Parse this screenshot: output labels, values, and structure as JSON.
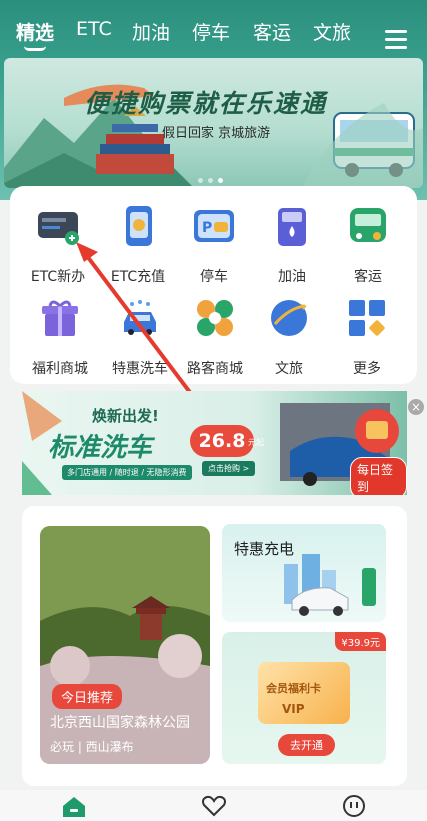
{
  "nav": {
    "tabs": [
      {
        "label": "精选",
        "active": true
      },
      {
        "label": "ETC",
        "active": false
      },
      {
        "label": "加油",
        "active": false
      },
      {
        "label": "停车",
        "active": false
      },
      {
        "label": "客运",
        "active": false
      },
      {
        "label": "文旅",
        "active": false
      }
    ],
    "menu_icon": "hamburger-menu-icon"
  },
  "banner": {
    "title": "便捷购票就在乐速通",
    "subtitle": "假日回家 京城旅游",
    "current_page": 3,
    "page_count": 3
  },
  "services": [
    {
      "label": "ETC新办",
      "icon": "etc-card-reader-icon"
    },
    {
      "label": "ETC充值",
      "icon": "etc-recharge-icon"
    },
    {
      "label": "停车",
      "icon": "parking-icon"
    },
    {
      "label": "加油",
      "icon": "fuel-pump-icon"
    },
    {
      "label": "客运",
      "icon": "bus-icon"
    },
    {
      "label": "福利商城",
      "icon": "gift-box-icon"
    },
    {
      "label": "特惠洗车",
      "icon": "car-wash-icon"
    },
    {
      "label": "路客商城",
      "icon": "mall-icon"
    },
    {
      "label": "文旅",
      "icon": "travel-globe-icon"
    },
    {
      "label": "更多",
      "icon": "more-grid-icon"
    }
  ],
  "promo": {
    "headline": "焕新出发!",
    "title": "标准洗车",
    "features": "多门店通用 / 随时退 / 无隐形消费",
    "price": "26.8",
    "price_unit": "元起",
    "buy_label": "点击抢购 >",
    "signin_label": "每日签到",
    "close_icon": "close-icon"
  },
  "recommend": {
    "tag": "今日推荐",
    "name": "北京西山国家森林公园",
    "sub": "必玩 | 西山瀑布"
  },
  "charge": {
    "title": "特惠充电"
  },
  "member": {
    "price": "¥39.9元",
    "card_title": "会员福利卡",
    "vip": "VIP",
    "open_label": "去开通"
  },
  "bottom_nav": [
    "home-icon",
    "heart-icon",
    "chat-icon"
  ],
  "colors": {
    "brand": "#2c8f7e",
    "accent": "#e8483c"
  }
}
